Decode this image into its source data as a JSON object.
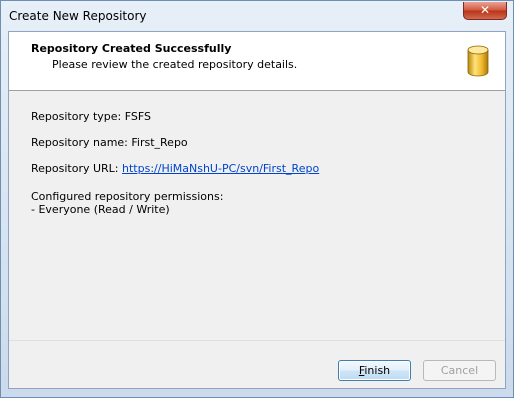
{
  "window": {
    "title": "Create New Repository",
    "close_label": "✕"
  },
  "header": {
    "title": "Repository Created Successfully",
    "subtitle": "Please review the created repository details.",
    "icon": "database-icon"
  },
  "details": {
    "type_label": "Repository type: FSFS",
    "name_label": "Repository name: First_Repo",
    "url_prefix": "Repository URL: ",
    "url": "https://HiMaNshU-PC/svn/First_Repo",
    "permissions_heading": "Configured repository permissions:",
    "permissions_entry": "- Everyone (Read / Write)"
  },
  "buttons": {
    "finish_first": "F",
    "finish_rest": "inish",
    "cancel": "Cancel"
  },
  "colors": {
    "link": "#0044cc",
    "icon_gold": "#e6b422"
  }
}
